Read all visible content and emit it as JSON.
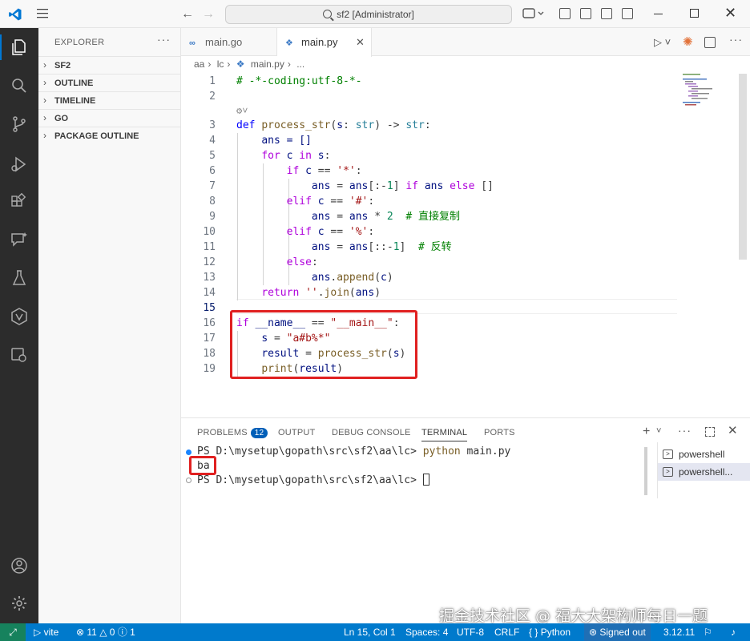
{
  "titlebar": {
    "search_text": "sf2 [Administrator]"
  },
  "sidebar": {
    "title": "EXPLORER",
    "more": "···",
    "sections": [
      {
        "label": "SF2"
      },
      {
        "label": "OUTLINE"
      },
      {
        "label": "TIMELINE"
      },
      {
        "label": "GO"
      },
      {
        "label": "PACKAGE OUTLINE"
      }
    ]
  },
  "tabs": [
    {
      "label": "main.go",
      "icon": "go-file-icon"
    },
    {
      "label": "main.py",
      "icon": "python-file-icon",
      "active": true
    }
  ],
  "breadcrumb": [
    "aa",
    "lc",
    "main.py",
    "..."
  ],
  "editor": {
    "lines": [
      {
        "n": "1",
        "text": "# -*-coding:utf-8-*-"
      },
      {
        "n": "2",
        "text": ""
      },
      {
        "n": "3",
        "text": "def process_str(s: str) -> str:"
      },
      {
        "n": "4",
        "text": "    ans = []"
      },
      {
        "n": "5",
        "text": "    for c in s:"
      },
      {
        "n": "6",
        "text": "        if c == '*':"
      },
      {
        "n": "7",
        "text": "            ans = ans[:-1] if ans else []"
      },
      {
        "n": "8",
        "text": "        elif c == '#':"
      },
      {
        "n": "9",
        "text": "            ans = ans * 2  # 直接复制"
      },
      {
        "n": "10",
        "text": "        elif c == '%':"
      },
      {
        "n": "11",
        "text": "            ans = ans[::-1]  # 反转"
      },
      {
        "n": "12",
        "text": "        else:"
      },
      {
        "n": "13",
        "text": "            ans.append(c)"
      },
      {
        "n": "14",
        "text": "    return ''.join(ans)"
      },
      {
        "n": "15",
        "text": ""
      },
      {
        "n": "16",
        "text": "if __name__ == \"__main__\":"
      },
      {
        "n": "17",
        "text": "    s = \"a#b%*\""
      },
      {
        "n": "18",
        "text": "    result = process_str(s)"
      },
      {
        "n": "19",
        "text": "    print(result)"
      }
    ]
  },
  "panel": {
    "tabs": [
      "PROBLEMS",
      "OUTPUT",
      "DEBUG CONSOLE",
      "TERMINAL",
      "PORTS"
    ],
    "problems_count": "12",
    "terminal": {
      "line1_prompt": "PS D:\\mysetup\\gopath\\src\\sf2\\aa\\lc> ",
      "line1_cmd_python": "python",
      "line1_cmd_rest": " main.py",
      "output": "ba",
      "line3_prompt": "PS D:\\mysetup\\gopath\\src\\sf2\\aa\\lc> "
    },
    "terminal_list": [
      "powershell",
      "powershell..."
    ]
  },
  "statusbar": {
    "branch": "vite",
    "errors": "11",
    "warnings": "0",
    "info": "1",
    "position": "Ln 15, Col 1",
    "spaces": "Spaces: 4",
    "encoding": "UTF-8",
    "eol": "CRLF",
    "language": "Python",
    "account": "Signed out",
    "python_version": "3.12.11"
  },
  "watermark": "掘金技术社区 @ 福大大架构师每日一题",
  "colors": {
    "activity_bg": "#2c2c2c",
    "status_bg": "#007acc",
    "highlight_box": "#e02020"
  }
}
